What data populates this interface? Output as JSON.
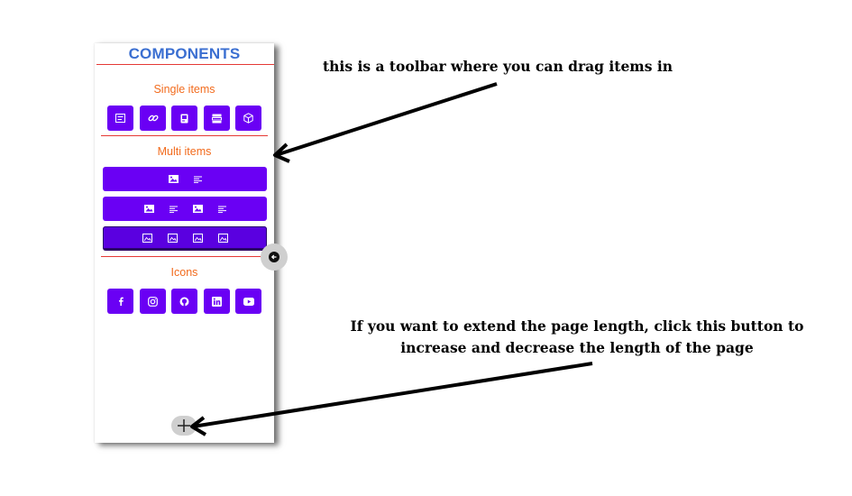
{
  "toolbar": {
    "title": "COMPONENTS",
    "single_title": "Single items",
    "single_items": [
      {
        "icon": "text-block-icon"
      },
      {
        "icon": "link-icon"
      },
      {
        "icon": "image-card-icon"
      },
      {
        "icon": "list-icon"
      },
      {
        "icon": "box-icon"
      }
    ],
    "multi_title": "Multi items",
    "multi_items": [
      {
        "icons": [
          "image-icon",
          "text-icon"
        ]
      },
      {
        "icons": [
          "image-icon",
          "text-icon",
          "image-icon",
          "text-icon"
        ]
      },
      {
        "icons": [
          "image-outline-icon",
          "image-outline-icon",
          "image-outline-icon",
          "image-outline-icon"
        ]
      }
    ],
    "icons_title": "Icons",
    "social_icons": [
      "facebook-icon",
      "instagram-icon",
      "github-icon",
      "linkedin-icon",
      "youtube-icon"
    ],
    "collapse_icon": "arrow-left-circle-icon",
    "extend_icon": "plus-icon"
  },
  "annotations": {
    "toolbar_note": "this is a toolbar where you can drag items in",
    "extend_note_line1": "If you want to extend the page length, click this button to",
    "extend_note_line2": "increase and decrease the length of the page"
  },
  "colors": {
    "title_blue": "#3b6fd1",
    "section_orange": "#f26b1d",
    "button_purple": "#6a00f4",
    "divider_red": "#e53935"
  }
}
